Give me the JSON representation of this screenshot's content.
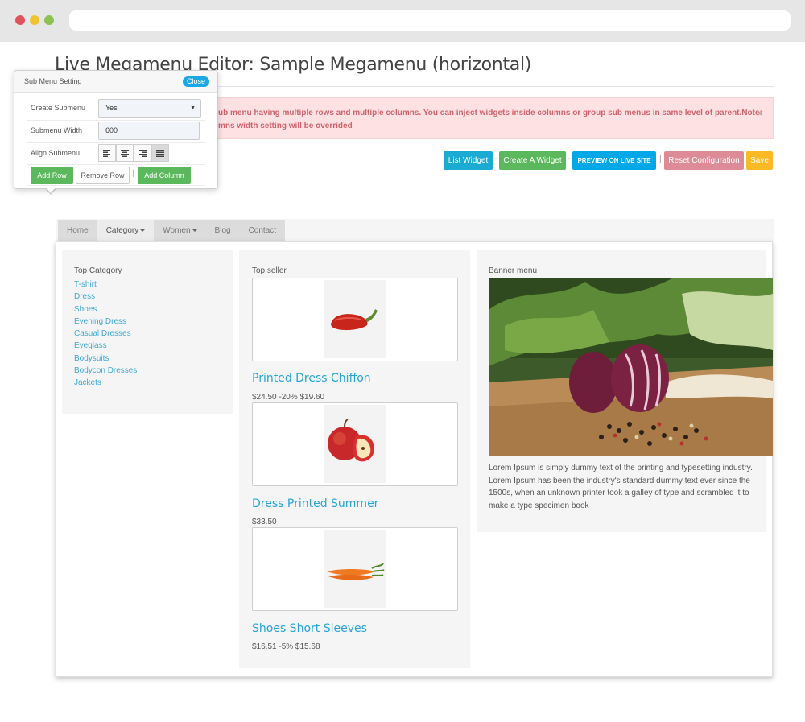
{
  "page": {
    "title": "Live Megamenu Editor: Sample Megamenu (horizontal)"
  },
  "alert": {
    "line1": "ub menu having multiple rows and multiple columns. You can inject widgets inside columns or group sub menus in same level of parent.Note:",
    "line2": "mns width setting will be overrided",
    "close": "×"
  },
  "toolbar": {
    "list_widget": "List Widget",
    "create_widget": "Create A Widget",
    "preview": "PREVIEW ON LIVE SITE",
    "reset": "Reset Configuration",
    "save": "Save",
    "sep1": "-",
    "sep2": "-",
    "sep3": "|"
  },
  "popup": {
    "title": "Sub Menu Setting",
    "close": "Close",
    "create_submenu_label": "Create Submenu",
    "create_submenu_value": "Yes",
    "submenu_width_label": "Submenu Width",
    "submenu_width_value": "600",
    "align_submenu_label": "Align Submenu",
    "align_options": [
      "align-left",
      "align-center",
      "align-right",
      "align-justify"
    ],
    "align_selected": "align-justify",
    "add_row": "Add Row",
    "remove_row": "Remove Row",
    "separator": "|",
    "add_column": "Add Column"
  },
  "menu": {
    "tabs": [
      {
        "label": "Home"
      },
      {
        "label": "Category"
      },
      {
        "label": "Women"
      },
      {
        "label": "Blog"
      },
      {
        "label": "Contact"
      }
    ],
    "active_tab": "Category"
  },
  "top_category": {
    "heading": "Top Category",
    "items": [
      "T-shirt",
      "Dress",
      "Shoes",
      "Evening Dress",
      "Casual Dresses",
      "Eyeglass",
      "Bodysuits",
      "Bodycon Dresses",
      "Jackets"
    ]
  },
  "top_seller": {
    "heading": "Top seller",
    "products": [
      {
        "name": "Printed Dress Chiffon",
        "price": "$24.50 -20% $19.60",
        "image": "red-pepper"
      },
      {
        "name": "Dress Printed Summer",
        "price": "$33.50",
        "image": "apple"
      },
      {
        "name": "Shoes Short Sleeves",
        "price": "$16.51 -5% $15.68",
        "image": "carrots"
      }
    ]
  },
  "banner_menu": {
    "heading": "Banner menu",
    "image": "onions-and-peppercorns",
    "description": "Lorem Ipsum is simply dummy text of the printing and typesetting industry. Lorem Ipsum has been the industry's standard dummy text ever since the 1500s, when an unknown printer took a galley of type and scrambled it to make a type specimen book"
  },
  "colors": {
    "link": "#3fa9d8",
    "product_name": "#25a6d9",
    "success": "#5cb85c",
    "info": "#1aabd2",
    "danger_light": "#dd8c97",
    "warning": "#f9ba26",
    "alert_bg": "#fde1e3",
    "alert_text": "#d0636b"
  }
}
